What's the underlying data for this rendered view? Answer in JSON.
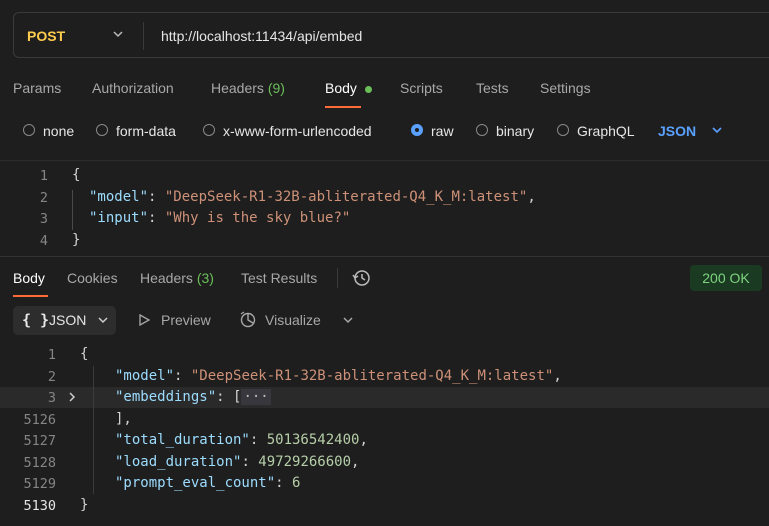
{
  "request": {
    "method": "POST",
    "url": "http://localhost:11434/api/embed"
  },
  "request_tabs": [
    {
      "label": "Params"
    },
    {
      "label": "Authorization"
    },
    {
      "label": "Headers",
      "count": "(9)"
    },
    {
      "label": "Body"
    },
    {
      "label": "Scripts"
    },
    {
      "label": "Tests"
    },
    {
      "label": "Settings"
    }
  ],
  "body_types": [
    "none",
    "form-data",
    "x-www-form-urlencoded",
    "raw",
    "binary",
    "GraphQL"
  ],
  "body_selected": "raw",
  "raw_format": "JSON",
  "request_body": {
    "line_numbers": [
      "1",
      "2",
      "3",
      "4"
    ],
    "open_brace": "{",
    "close_brace": "}",
    "model_key": "\"model\"",
    "model_value": "\"DeepSeek-R1-32B-abliterated-Q4_K_M:latest\"",
    "input_key": "\"input\"",
    "input_value": "\"Why is the sky blue?\""
  },
  "response_tabs": [
    {
      "label": "Body"
    },
    {
      "label": "Cookies"
    },
    {
      "label": "Headers",
      "count": "(3)"
    },
    {
      "label": "Test Results"
    }
  ],
  "status": "200 OK",
  "response_toolbar": {
    "format_icon": "{ }",
    "format": "JSON",
    "preview": "Preview",
    "visualize": "Visualize"
  },
  "response_body": {
    "line_numbers": [
      "1",
      "2",
      "3",
      "5126",
      "5127",
      "5128",
      "5129",
      "5130"
    ],
    "open_brace": "{",
    "close_brace": "}",
    "model_key": "\"model\"",
    "model_value": "\"DeepSeek-R1-32B-abliterated-Q4_K_M:latest\"",
    "embeddings_key": "\"embeddings\"",
    "embeddings_open": "[",
    "embeddings_collapsed": "···",
    "embeddings_close": "],",
    "total_duration_key": "\"total_duration\"",
    "total_duration": "50136542400",
    "load_duration_key": "\"load_duration\"",
    "load_duration": "49729266600",
    "prompt_eval_count_key": "\"prompt_eval_count\"",
    "prompt_eval_count": "6"
  },
  "colors": {
    "method": "#ffcc4d",
    "accent": "#ff6c37",
    "selected_blue": "#5aa1ff",
    "success": "#6bbf59"
  },
  "icons": [
    "chevron-down-icon",
    "history-icon",
    "play-icon",
    "visualize-icon",
    "chevron-right-icon"
  ]
}
